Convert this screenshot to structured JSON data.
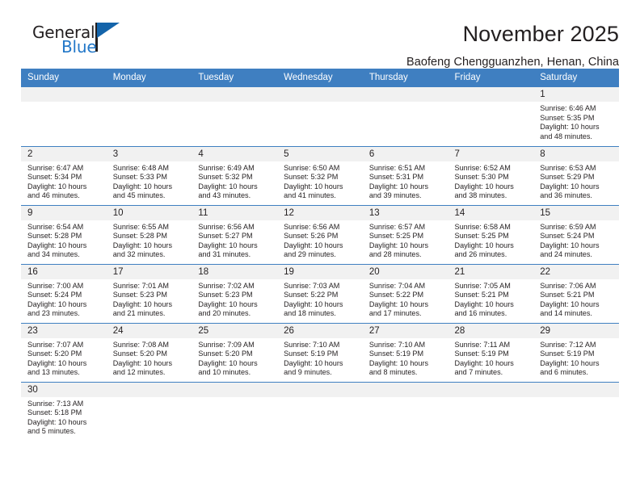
{
  "logo": {
    "word_one": "General",
    "word_two": "Blue"
  },
  "header": {
    "title": "November 2025",
    "subtitle": "Baofeng Chengguanzhen, Henan, China"
  },
  "colors": {
    "header_blue": "#3f7fc1",
    "logo_blue": "#2277c8",
    "daynum_bg": "#f1f1f1",
    "text": "#231f20"
  },
  "weekdays": [
    "Sunday",
    "Monday",
    "Tuesday",
    "Wednesday",
    "Thursday",
    "Friday",
    "Saturday"
  ],
  "weeks": [
    [
      {
        "day": "",
        "sunrise": "",
        "sunset": "",
        "daylight_1": "",
        "daylight_2": ""
      },
      {
        "day": "",
        "sunrise": "",
        "sunset": "",
        "daylight_1": "",
        "daylight_2": ""
      },
      {
        "day": "",
        "sunrise": "",
        "sunset": "",
        "daylight_1": "",
        "daylight_2": ""
      },
      {
        "day": "",
        "sunrise": "",
        "sunset": "",
        "daylight_1": "",
        "daylight_2": ""
      },
      {
        "day": "",
        "sunrise": "",
        "sunset": "",
        "daylight_1": "",
        "daylight_2": ""
      },
      {
        "day": "",
        "sunrise": "",
        "sunset": "",
        "daylight_1": "",
        "daylight_2": ""
      },
      {
        "day": "1",
        "sunrise": "Sunrise: 6:46 AM",
        "sunset": "Sunset: 5:35 PM",
        "daylight_1": "Daylight: 10 hours",
        "daylight_2": "and 48 minutes."
      }
    ],
    [
      {
        "day": "2",
        "sunrise": "Sunrise: 6:47 AM",
        "sunset": "Sunset: 5:34 PM",
        "daylight_1": "Daylight: 10 hours",
        "daylight_2": "and 46 minutes."
      },
      {
        "day": "3",
        "sunrise": "Sunrise: 6:48 AM",
        "sunset": "Sunset: 5:33 PM",
        "daylight_1": "Daylight: 10 hours",
        "daylight_2": "and 45 minutes."
      },
      {
        "day": "4",
        "sunrise": "Sunrise: 6:49 AM",
        "sunset": "Sunset: 5:32 PM",
        "daylight_1": "Daylight: 10 hours",
        "daylight_2": "and 43 minutes."
      },
      {
        "day": "5",
        "sunrise": "Sunrise: 6:50 AM",
        "sunset": "Sunset: 5:32 PM",
        "daylight_1": "Daylight: 10 hours",
        "daylight_2": "and 41 minutes."
      },
      {
        "day": "6",
        "sunrise": "Sunrise: 6:51 AM",
        "sunset": "Sunset: 5:31 PM",
        "daylight_1": "Daylight: 10 hours",
        "daylight_2": "and 39 minutes."
      },
      {
        "day": "7",
        "sunrise": "Sunrise: 6:52 AM",
        "sunset": "Sunset: 5:30 PM",
        "daylight_1": "Daylight: 10 hours",
        "daylight_2": "and 38 minutes."
      },
      {
        "day": "8",
        "sunrise": "Sunrise: 6:53 AM",
        "sunset": "Sunset: 5:29 PM",
        "daylight_1": "Daylight: 10 hours",
        "daylight_2": "and 36 minutes."
      }
    ],
    [
      {
        "day": "9",
        "sunrise": "Sunrise: 6:54 AM",
        "sunset": "Sunset: 5:28 PM",
        "daylight_1": "Daylight: 10 hours",
        "daylight_2": "and 34 minutes."
      },
      {
        "day": "10",
        "sunrise": "Sunrise: 6:55 AM",
        "sunset": "Sunset: 5:28 PM",
        "daylight_1": "Daylight: 10 hours",
        "daylight_2": "and 32 minutes."
      },
      {
        "day": "11",
        "sunrise": "Sunrise: 6:56 AM",
        "sunset": "Sunset: 5:27 PM",
        "daylight_1": "Daylight: 10 hours",
        "daylight_2": "and 31 minutes."
      },
      {
        "day": "12",
        "sunrise": "Sunrise: 6:56 AM",
        "sunset": "Sunset: 5:26 PM",
        "daylight_1": "Daylight: 10 hours",
        "daylight_2": "and 29 minutes."
      },
      {
        "day": "13",
        "sunrise": "Sunrise: 6:57 AM",
        "sunset": "Sunset: 5:25 PM",
        "daylight_1": "Daylight: 10 hours",
        "daylight_2": "and 28 minutes."
      },
      {
        "day": "14",
        "sunrise": "Sunrise: 6:58 AM",
        "sunset": "Sunset: 5:25 PM",
        "daylight_1": "Daylight: 10 hours",
        "daylight_2": "and 26 minutes."
      },
      {
        "day": "15",
        "sunrise": "Sunrise: 6:59 AM",
        "sunset": "Sunset: 5:24 PM",
        "daylight_1": "Daylight: 10 hours",
        "daylight_2": "and 24 minutes."
      }
    ],
    [
      {
        "day": "16",
        "sunrise": "Sunrise: 7:00 AM",
        "sunset": "Sunset: 5:24 PM",
        "daylight_1": "Daylight: 10 hours",
        "daylight_2": "and 23 minutes."
      },
      {
        "day": "17",
        "sunrise": "Sunrise: 7:01 AM",
        "sunset": "Sunset: 5:23 PM",
        "daylight_1": "Daylight: 10 hours",
        "daylight_2": "and 21 minutes."
      },
      {
        "day": "18",
        "sunrise": "Sunrise: 7:02 AM",
        "sunset": "Sunset: 5:23 PM",
        "daylight_1": "Daylight: 10 hours",
        "daylight_2": "and 20 minutes."
      },
      {
        "day": "19",
        "sunrise": "Sunrise: 7:03 AM",
        "sunset": "Sunset: 5:22 PM",
        "daylight_1": "Daylight: 10 hours",
        "daylight_2": "and 18 minutes."
      },
      {
        "day": "20",
        "sunrise": "Sunrise: 7:04 AM",
        "sunset": "Sunset: 5:22 PM",
        "daylight_1": "Daylight: 10 hours",
        "daylight_2": "and 17 minutes."
      },
      {
        "day": "21",
        "sunrise": "Sunrise: 7:05 AM",
        "sunset": "Sunset: 5:21 PM",
        "daylight_1": "Daylight: 10 hours",
        "daylight_2": "and 16 minutes."
      },
      {
        "day": "22",
        "sunrise": "Sunrise: 7:06 AM",
        "sunset": "Sunset: 5:21 PM",
        "daylight_1": "Daylight: 10 hours",
        "daylight_2": "and 14 minutes."
      }
    ],
    [
      {
        "day": "23",
        "sunrise": "Sunrise: 7:07 AM",
        "sunset": "Sunset: 5:20 PM",
        "daylight_1": "Daylight: 10 hours",
        "daylight_2": "and 13 minutes."
      },
      {
        "day": "24",
        "sunrise": "Sunrise: 7:08 AM",
        "sunset": "Sunset: 5:20 PM",
        "daylight_1": "Daylight: 10 hours",
        "daylight_2": "and 12 minutes."
      },
      {
        "day": "25",
        "sunrise": "Sunrise: 7:09 AM",
        "sunset": "Sunset: 5:20 PM",
        "daylight_1": "Daylight: 10 hours",
        "daylight_2": "and 10 minutes."
      },
      {
        "day": "26",
        "sunrise": "Sunrise: 7:10 AM",
        "sunset": "Sunset: 5:19 PM",
        "daylight_1": "Daylight: 10 hours",
        "daylight_2": "and 9 minutes."
      },
      {
        "day": "27",
        "sunrise": "Sunrise: 7:10 AM",
        "sunset": "Sunset: 5:19 PM",
        "daylight_1": "Daylight: 10 hours",
        "daylight_2": "and 8 minutes."
      },
      {
        "day": "28",
        "sunrise": "Sunrise: 7:11 AM",
        "sunset": "Sunset: 5:19 PM",
        "daylight_1": "Daylight: 10 hours",
        "daylight_2": "and 7 minutes."
      },
      {
        "day": "29",
        "sunrise": "Sunrise: 7:12 AM",
        "sunset": "Sunset: 5:19 PM",
        "daylight_1": "Daylight: 10 hours",
        "daylight_2": "and 6 minutes."
      }
    ],
    [
      {
        "day": "30",
        "sunrise": "Sunrise: 7:13 AM",
        "sunset": "Sunset: 5:18 PM",
        "daylight_1": "Daylight: 10 hours",
        "daylight_2": "and 5 minutes."
      },
      {
        "day": "",
        "sunrise": "",
        "sunset": "",
        "daylight_1": "",
        "daylight_2": ""
      },
      {
        "day": "",
        "sunrise": "",
        "sunset": "",
        "daylight_1": "",
        "daylight_2": ""
      },
      {
        "day": "",
        "sunrise": "",
        "sunset": "",
        "daylight_1": "",
        "daylight_2": ""
      },
      {
        "day": "",
        "sunrise": "",
        "sunset": "",
        "daylight_1": "",
        "daylight_2": ""
      },
      {
        "day": "",
        "sunrise": "",
        "sunset": "",
        "daylight_1": "",
        "daylight_2": ""
      },
      {
        "day": "",
        "sunrise": "",
        "sunset": "",
        "daylight_1": "",
        "daylight_2": ""
      }
    ]
  ]
}
